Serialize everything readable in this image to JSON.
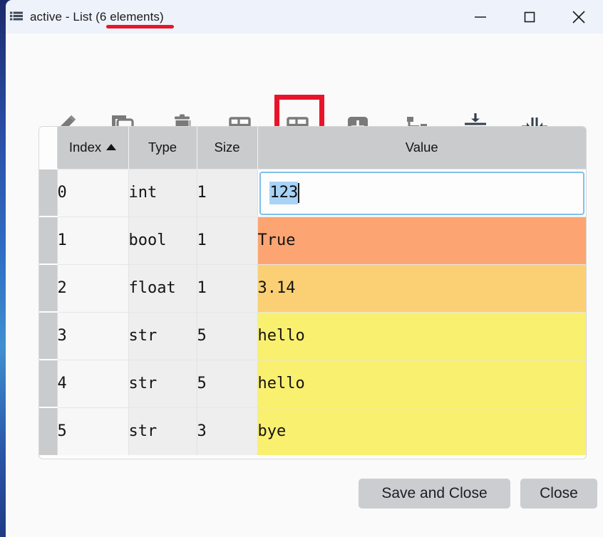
{
  "window": {
    "title": "active - List (6 elements)",
    "icon": "list-table-icon",
    "controls": {
      "minimize": "minimize-icon",
      "maximize": "maximize-icon",
      "close": "close-icon"
    }
  },
  "annotation": {
    "title_underline_color": "#e8152a",
    "highlight_box_color": "#e8152a",
    "highlighted_tool": "import-table-down"
  },
  "toolbar": {
    "items": [
      {
        "name": "edit-pencil-icon",
        "tooltip": "Edit"
      },
      {
        "name": "copy-icon",
        "tooltip": "Copy"
      },
      {
        "name": "trash-delete-icon",
        "tooltip": "Remove"
      },
      {
        "name": "table-export-up-icon",
        "tooltip": "Export"
      },
      {
        "name": "table-import-down-icon",
        "tooltip": "Import"
      },
      {
        "name": "plus-square-icon",
        "tooltip": "Insert"
      },
      {
        "name": "hierarchy-tree-icon",
        "tooltip": "Show dependencies"
      },
      {
        "name": "collapse-rows-icon",
        "tooltip": "Resize rows to contents"
      },
      {
        "name": "collapse-columns-icon",
        "tooltip": "Resize columns to contents"
      }
    ]
  },
  "table": {
    "columns": [
      {
        "key": "index",
        "label": "Index",
        "sorted": "asc"
      },
      {
        "key": "type",
        "label": "Type",
        "sorted": ""
      },
      {
        "key": "size",
        "label": "Size",
        "sorted": ""
      },
      {
        "key": "value",
        "label": "Value",
        "sorted": ""
      }
    ],
    "sort_indicator": "▲",
    "rows": [
      {
        "index": "0",
        "type": "int",
        "size": "1",
        "value": "123",
        "value_color": "#fdfdfd",
        "editing": true,
        "selected_text": "123"
      },
      {
        "index": "1",
        "type": "bool",
        "size": "1",
        "value": "True",
        "value_color": "#fca573",
        "editing": false,
        "selected_text": ""
      },
      {
        "index": "2",
        "type": "float",
        "size": "1",
        "value": "3.14",
        "value_color": "#fbd075",
        "editing": false,
        "selected_text": ""
      },
      {
        "index": "3",
        "type": "str",
        "size": "5",
        "value": "hello",
        "value_color": "#faf070",
        "editing": false,
        "selected_text": ""
      },
      {
        "index": "4",
        "type": "str",
        "size": "5",
        "value": "hello",
        "value_color": "#faf070",
        "editing": false,
        "selected_text": ""
      },
      {
        "index": "5",
        "type": "str",
        "size": "3",
        "value": "bye",
        "value_color": "#faf070",
        "editing": false,
        "selected_text": ""
      }
    ]
  },
  "footer": {
    "save_and_close_label": "Save and Close",
    "close_label": "Close"
  }
}
